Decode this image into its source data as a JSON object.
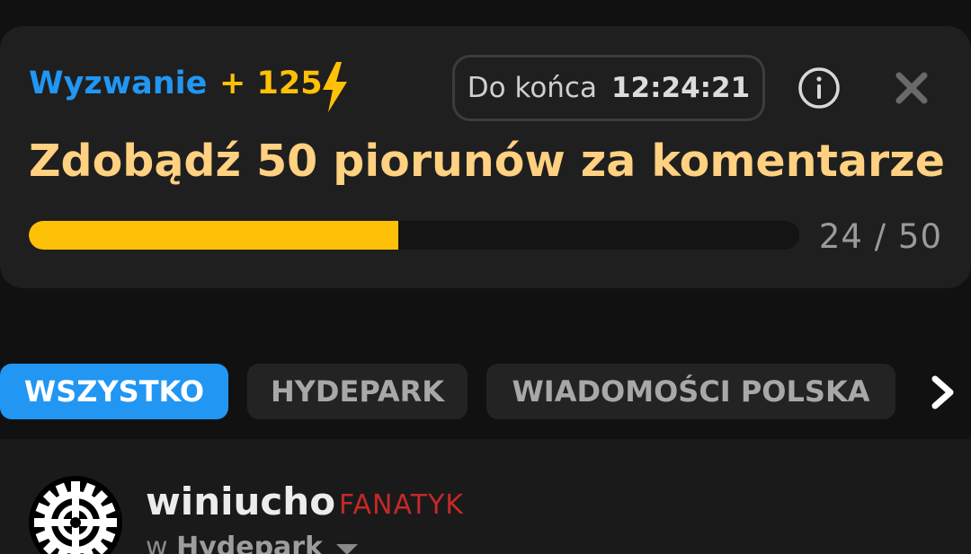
{
  "challenge": {
    "label": "Wyzwanie",
    "points": "+ 125",
    "timer_label": "Do końca",
    "timer_value": "12:24:21",
    "title": "Zdobądź 50 piorunów za komentarze",
    "progress": {
      "current": 24,
      "total": 50,
      "text": "24 / 50"
    },
    "icons": [
      "bolt-icon",
      "info-icon",
      "close-icon"
    ]
  },
  "filters": {
    "chips": [
      {
        "label": "WSZYSTKO",
        "active": true
      },
      {
        "label": "HYDEPARK",
        "active": false
      },
      {
        "label": "WIADOMOŚCI POLSKA",
        "active": false
      }
    ],
    "next_icon": "chevron-right-icon"
  },
  "post": {
    "username": "winiucho",
    "rank": "FANATYK",
    "prefix": "w",
    "channel": "Hydepark",
    "avatar_icon": "gear-avatar",
    "menu_icon": "caret-down-icon"
  },
  "colors": {
    "accent_blue": "#2196f3",
    "accent_yellow": "#ffc107",
    "title_gold": "#ffd180",
    "rank_red": "#c62828",
    "background": "#111111",
    "card": "#1f1f1f"
  }
}
